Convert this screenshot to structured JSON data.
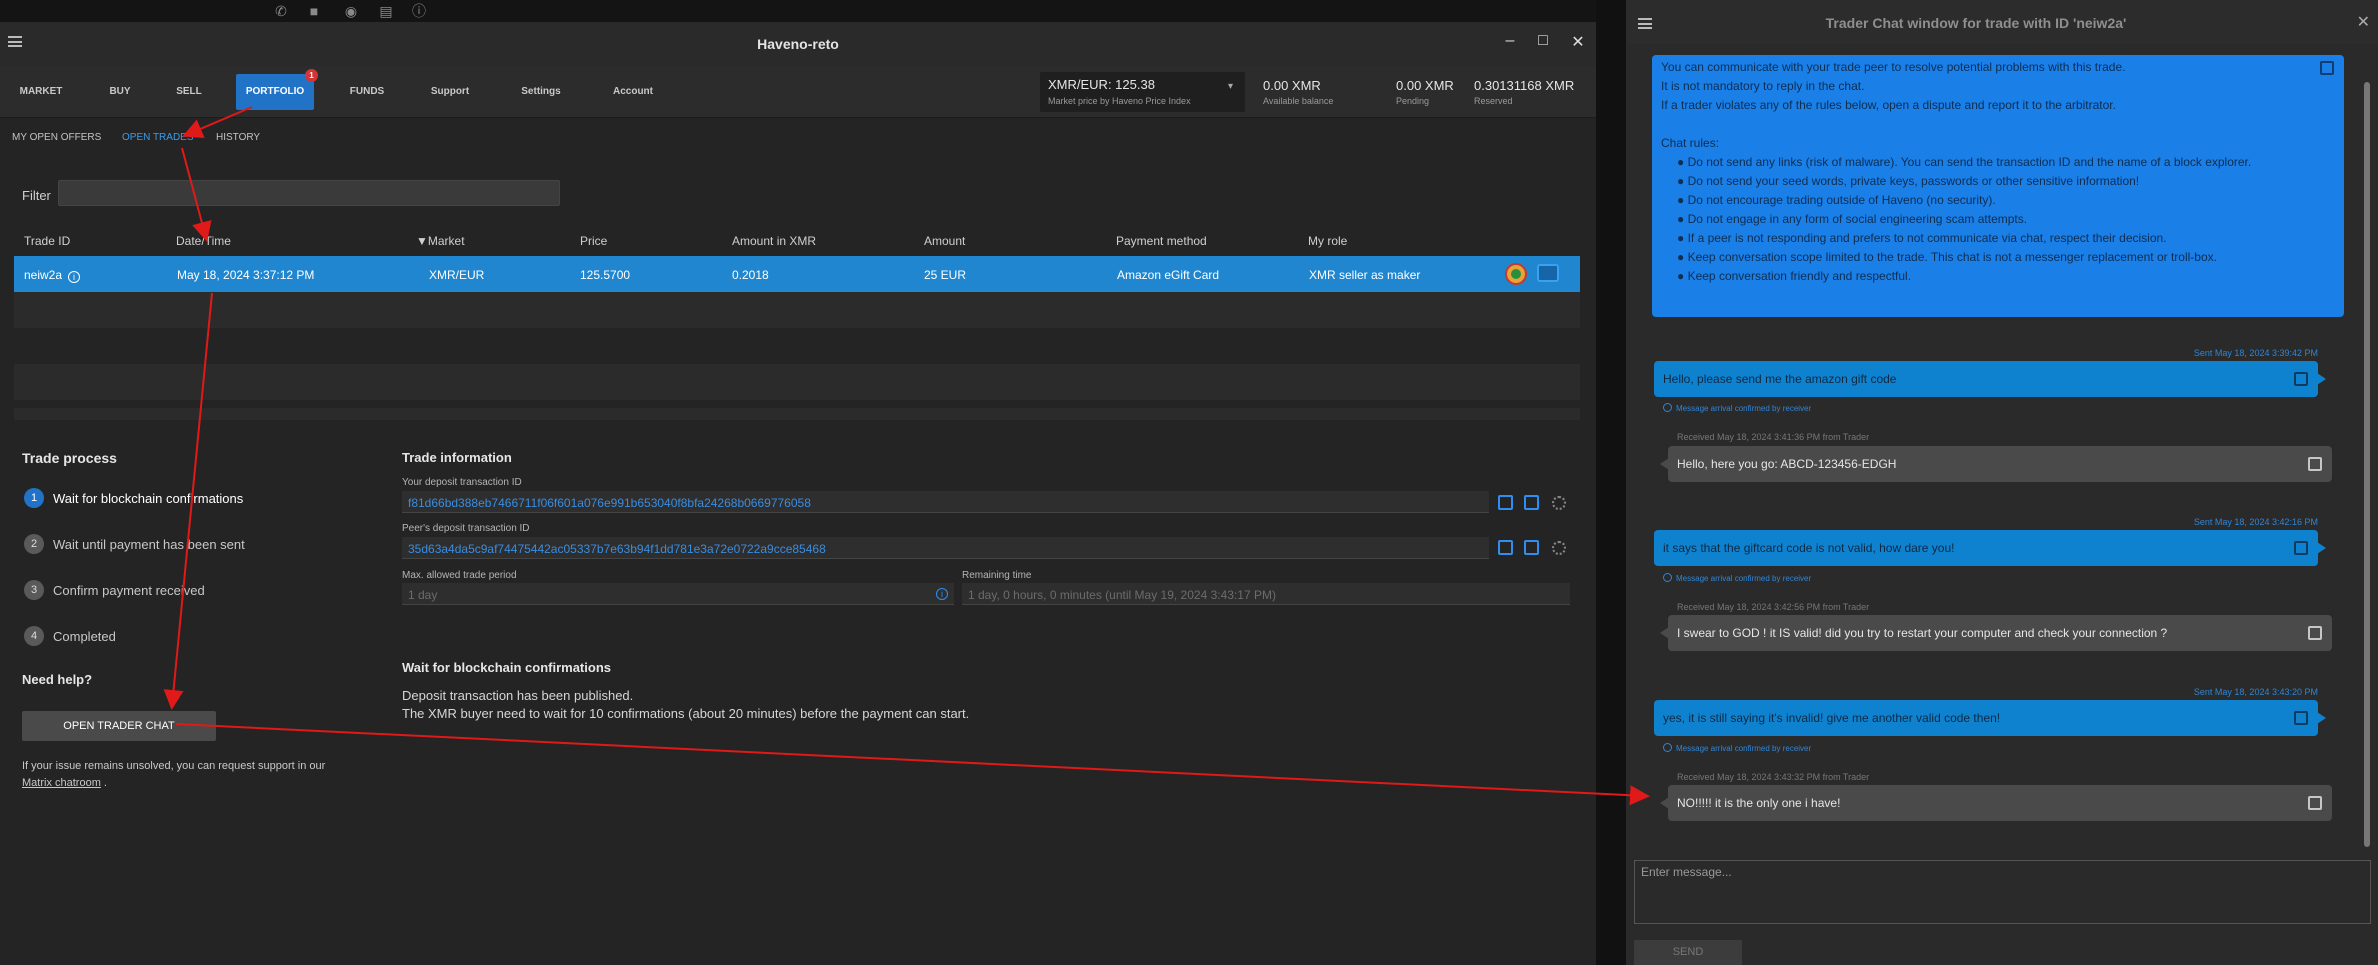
{
  "desktop": {
    "topbar_icons": [
      "phone-icon",
      "video-icon",
      "search-icon",
      "notes-icon",
      "info-icon"
    ]
  },
  "main": {
    "title": "Haveno-reto",
    "nav": [
      "MARKET",
      "BUY",
      "SELL",
      "PORTFOLIO",
      "FUNDS",
      "Support",
      "Settings",
      "Account"
    ],
    "portfolio_badge": "1",
    "price": {
      "value": "XMR/EUR: 125.38",
      "sub": "Market price by Haveno Price Index"
    },
    "balances": [
      {
        "value": "0.00 XMR",
        "label": "Available balance"
      },
      {
        "value": "0.00 XMR",
        "label": "Pending"
      },
      {
        "value": "0.30131168 XMR",
        "label": "Reserved"
      }
    ],
    "subtabs": [
      "MY OPEN OFFERS",
      "OPEN TRADES",
      "HISTORY"
    ],
    "filter_label": "Filter",
    "table": {
      "headers": [
        "Trade ID",
        "Date/Time",
        "Market",
        "Price",
        "Amount in XMR",
        "Amount",
        "Payment method",
        "My role"
      ],
      "sort_mark": "▼",
      "row": [
        "neiw2a",
        "May 18, 2024 3:37:12 PM",
        "XMR/EUR",
        "125.5700",
        "0.2018",
        "25 EUR",
        "Amazon eGift Card",
        "XMR seller as maker"
      ]
    },
    "trade_process": {
      "title": "Trade process",
      "steps": [
        "Wait for blockchain confirmations",
        "Wait until payment has been sent",
        "Confirm payment received",
        "Completed"
      ],
      "step_nums": [
        "1",
        "2",
        "3",
        "4"
      ]
    },
    "need_help": "Need help?",
    "open_chat_button": "OPEN TRADER CHAT",
    "help_text": "If your issue remains unsolved, you can request support in our",
    "help_link": "Matrix chatroom",
    "help_end": ".",
    "trade_info": {
      "title": "Trade information",
      "deposit_label": "Your deposit transaction ID",
      "deposit_value": "f81d66bd388eb7466711f06f601a076e991b653040f8bfa24268b0669776058",
      "peer_label": "Peer's deposit transaction ID",
      "peer_value": "35d63a4da5c9af74475442ac05337b7e63b94f1dd781e3a72e0722a9cce85468",
      "period_label": "Max. allowed trade period",
      "period_value": "1 day",
      "remaining_label": "Remaining time",
      "remaining_value": "1 day, 0 hours, 0 minutes (until May 19, 2024 3:43:17 PM)"
    },
    "wait": {
      "title": "Wait for blockchain confirmations",
      "line1": "Deposit transaction has been published.",
      "line2": "The XMR buyer need to wait for 10 confirmations (about 20 minutes) before the payment can start."
    }
  },
  "chat": {
    "title": "Trader Chat window for trade with ID 'neiw2a'",
    "rules": {
      "intro1": "You can communicate with your trade peer to resolve potential problems with this trade.",
      "intro2": "It is not mandatory to reply in the chat.",
      "intro3": "If a trader violates any of the rules below, open a dispute and report it to the arbitrator.",
      "heading": "Chat rules:",
      "items": [
        "● Do not send any links (risk of malware). You can send the transaction ID and the name of a block explorer.",
        "● Do not send your seed words, private keys, passwords or other sensitive information!",
        "● Do not encourage trading outside of Haveno (no security).",
        "● Do not engage in any form of social engineering scam attempts.",
        "● If a peer is not responding and prefers to not communicate via chat, respect their decision.",
        "● Keep conversation scope limited to the trade. This chat is not a messenger replacement or troll-box.",
        "● Keep conversation friendly and respectful."
      ]
    },
    "messages": [
      {
        "dir": "me",
        "ts": "Sent May 18, 2024 3:39:42 PM",
        "text": "Hello, please send me the amazon gift code",
        "status": "Message arrival confirmed by receiver"
      },
      {
        "dir": "peer",
        "ts": "Received May 18, 2024 3:41:36 PM from Trader",
        "text": "Hello, here you go: ABCD-123456-EDGH"
      },
      {
        "dir": "me",
        "ts": "Sent May 18, 2024 3:42:16 PM",
        "text": "it says that the giftcard code is not valid, how dare you!",
        "status": "Message arrival confirmed by receiver"
      },
      {
        "dir": "peer",
        "ts": "Received May 18, 2024 3:42:56 PM from Trader",
        "text": "I swear to GOD ! it IS valid! did you try to restart your computer and check your connection ?"
      },
      {
        "dir": "me",
        "ts": "Sent May 18, 2024 3:43:20 PM",
        "text": "yes, it is still saying it's invalid!  give me another valid code then!",
        "status": "Message arrival confirmed by receiver"
      },
      {
        "dir": "peer",
        "ts": "Received May 18, 2024 3:43:32 PM from Trader",
        "text": "NO!!!!! it is the only one i have!"
      }
    ],
    "input_placeholder": "Enter message...",
    "send_label": "SEND"
  },
  "colors": {
    "accent": "#2173c8",
    "arrow": "#e01919",
    "selected_row": "#1f86cf",
    "chat_me": "#0f82cf",
    "chat_peer": "#4a4a4a"
  }
}
